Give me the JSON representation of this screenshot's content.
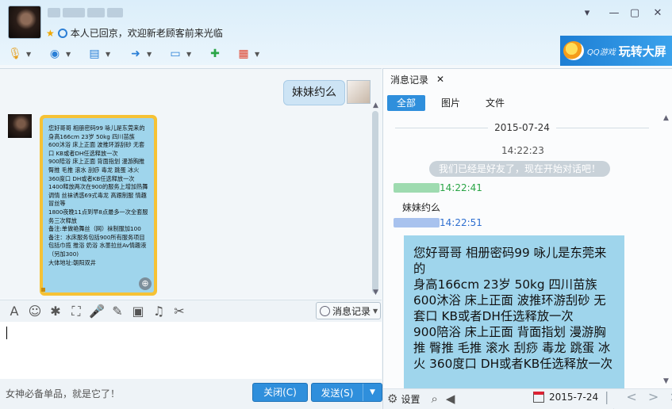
{
  "header": {
    "nickname_blurred": "",
    "status_text": "本人已回京，欢迎新老顾客前来光临",
    "window_controls": [
      "chevron-down-icon",
      "minimize-icon",
      "maximize-icon",
      "close-icon"
    ]
  },
  "toolbar": {
    "icons": [
      "microphone-icon",
      "video-call-icon",
      "screen-share-icon",
      "file-transfer-icon",
      "remote-desktop-icon",
      "new-chat-icon",
      "apps-icon"
    ]
  },
  "banner": {
    "logo_text": "QQ游戏",
    "tagline": "玩转大屏"
  },
  "chat": {
    "my_message": "妹妹约么",
    "image_message_text": [
      "您好哥哥 相册密码99 咏儿是东莞来的",
      "身高166cm 23岁 50kg 四川苗族",
      "600沐浴 床上正面 波推环游刮砂 无套口 KB或者DH任选释放一次",
      "900陪浴 床上正面 背面指划 漫游胸推 臀推 毛推 滚水 刮痧 毒龙 跳蛋 冰火  360度口 DH或者KB任选释放一次",
      "1400释放两次在900的服务上增加热舞调情 丝袜诱惑69式毒龙 高跟制服 情趣 冒丝等",
      "1800夜晚11点到早8点最多一次全套服务三次释放",
      "备注:单做艳舞丝（网）袜制服加100",
      "备注：水床服务包括900所有服务项目 包括巾揽  推浴 奶浴 水墨拉丝Av情趣液（另加300)",
      "大体地址:朝阳双井"
    ]
  },
  "input_toolbar": {
    "icons": [
      "font-icon",
      "emoji-icon",
      "poke-icon",
      "screenshot-icon",
      "voice-icon",
      "edit-icon",
      "image-icon",
      "music-icon",
      "scissors-icon"
    ],
    "history_label": "消息记录"
  },
  "bottom": {
    "ad_text": "女神必备单品，就是它了！",
    "close_label": "关闭(C)",
    "send_label": "发送(S)"
  },
  "history": {
    "tab_label": "消息记录",
    "filters": [
      "全部",
      "图片",
      "文件"
    ],
    "date": "2015-07-24",
    "time1": "14:22:23",
    "system_message": "我们已经是好友了，现在开始对话吧！",
    "msg1_time": "14:22:41",
    "msg1_text": "妹妹约么",
    "msg2_time": "14:22:51",
    "image_text": [
      "您好哥哥 相册密码99 咏儿是东莞来的",
      "身高166cm 23岁 50kg 四川苗族",
      "600沐浴 床上正面 波推环游刮砂 无套口 KB或者DH任选释放一次",
      "900陪浴 床上正面 背面指划 漫游胸推 臀推 毛推 滚水 刮痧 毒龙 跳蛋 冰火  360度口 DH或者KB任选释放一次"
    ],
    "settings_label": "设置",
    "footer_date": "2015-7-24"
  }
}
